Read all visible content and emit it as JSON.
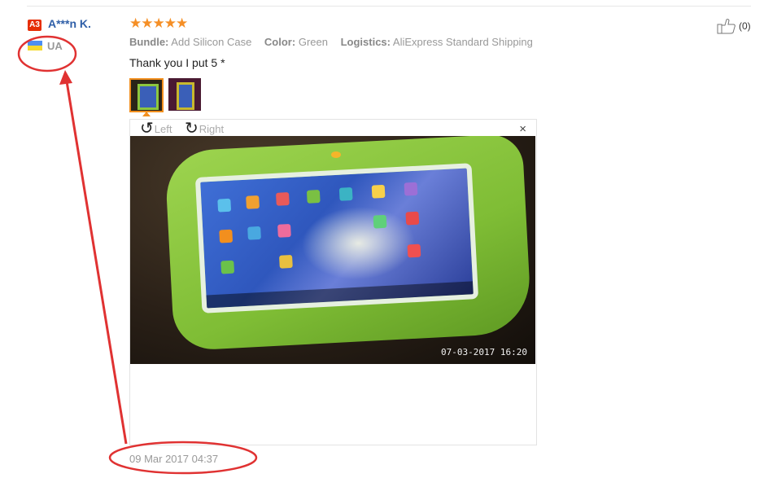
{
  "reviewer": {
    "level_badge": "A3",
    "name": "A***n K.",
    "country": "UA"
  },
  "review": {
    "stars": "★★★★★",
    "attributes": [
      {
        "key": "Bundle:",
        "value": "Add Silicon Case"
      },
      {
        "key": "Color:",
        "value": "Green"
      },
      {
        "key": "Logistics:",
        "value": "AliExpress Standard Shipping"
      }
    ],
    "text": "Thank you I put 5 *",
    "date": "09 Mar 2017 04:37",
    "helpful_count": "(0)"
  },
  "viewer": {
    "rotate_left_label": "Left",
    "rotate_right_label": "Right",
    "close_symbol": "×",
    "photo_timestamp": "07-03-2017 16:20"
  },
  "icons": {
    "rotate_left": "↺",
    "rotate_right": "↻"
  },
  "colors": {
    "star": "#f58f26",
    "name": "#2f5fa8",
    "badge": "#e62e04",
    "annotation": "#e03232",
    "thumb_selected": "#f28f1e"
  }
}
